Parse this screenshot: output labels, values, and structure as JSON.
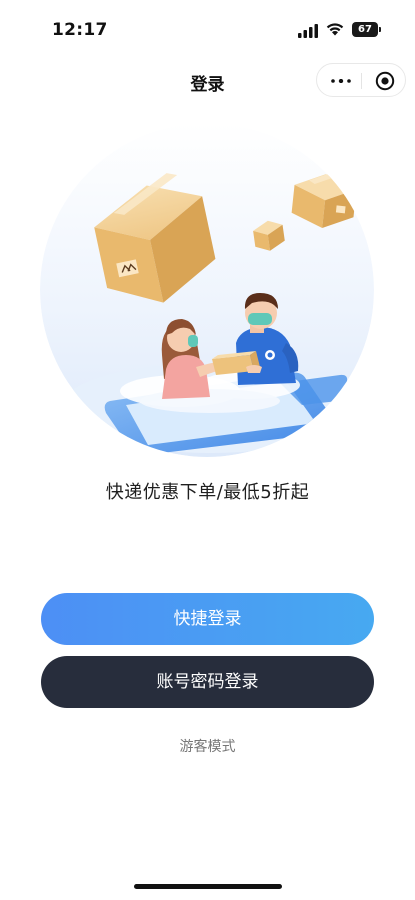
{
  "status_bar": {
    "time": "12:17",
    "battery": "67"
  },
  "nav": {
    "title": "登录",
    "more_icon": "more-dots-icon",
    "close_icon": "target-circle-icon"
  },
  "hero": {
    "illustration": "courier-delivering-package-illustration"
  },
  "slogan": "快递优惠下单/最低5折起",
  "buttons": {
    "quick_login": "快捷登录",
    "account_login": "账号密码登录"
  },
  "guest_mode": "游客模式",
  "colors": {
    "quick_login_start": "#4d8ff5",
    "quick_login_end": "#47a9f1",
    "account_login": "#272d3c",
    "guest_text": "#777777"
  }
}
